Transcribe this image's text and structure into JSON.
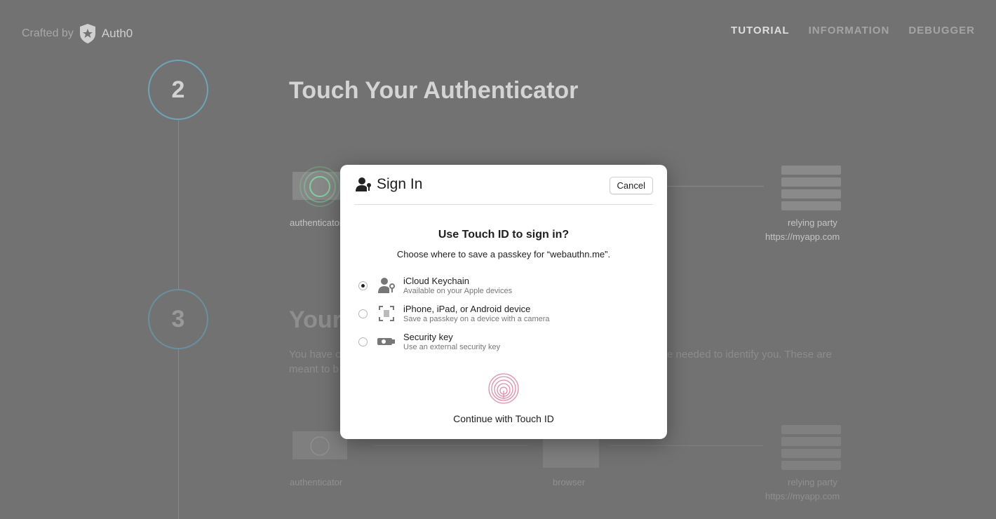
{
  "header": {
    "crafted_by": "Crafted by",
    "brand": "Auth0",
    "nav": [
      {
        "label": "TUTORIAL",
        "active": true
      },
      {
        "label": "INFORMATION",
        "active": false
      },
      {
        "label": "DEBUGGER",
        "active": false
      }
    ]
  },
  "steps": [
    {
      "number": "2",
      "title": "Touch Your Authenticator",
      "labels": {
        "authenticator": "authenticator",
        "relying_party": "relying party",
        "rp_url": "https://myapp.com"
      }
    },
    {
      "number": "3",
      "title": "Your",
      "paragraph_start": "You have c",
      "paragraph_end": "e needed to identify you. These are",
      "paragraph_line2": "meant to b",
      "labels": {
        "authenticator": "authenticator",
        "browser": "browser",
        "relying_party": "relying party",
        "rp_url": "https://myapp.com"
      }
    }
  ],
  "dialog": {
    "title": "Sign In",
    "cancel": "Cancel",
    "question": "Use Touch ID to sign in?",
    "subtitle": "Choose where to save a passkey for “webauthn.me”.",
    "options": [
      {
        "title": "iCloud Keychain",
        "desc": "Available on your Apple devices",
        "icon": "person-key-icon",
        "selected": true
      },
      {
        "title": "iPhone, iPad, or Android device",
        "desc": "Save a passkey on a device with a camera",
        "icon": "qr-code-icon",
        "selected": false
      },
      {
        "title": "Security key",
        "desc": "Use an external security key",
        "icon": "security-key-icon",
        "selected": false
      }
    ],
    "continue": "Continue with Touch ID"
  },
  "colors": {
    "step_ring": "#6fa3b8",
    "touch_ring": "#7fcf9c",
    "fingerprint": "#e88aa8"
  }
}
